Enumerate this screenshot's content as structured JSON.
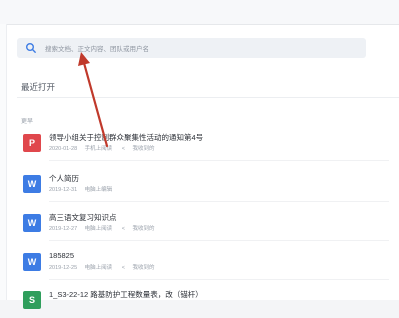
{
  "search": {
    "placeholder": "搜索文档、正文内容、团队或用户名"
  },
  "section_title": "最近打开",
  "group_label": "更早",
  "colors": {
    "pdf_icon": "#e0474c",
    "word_icon": "#3d7ce4"
  },
  "files": [
    {
      "name": "领导小组关于控制群众聚集性活动的通知第4号",
      "date": "2020-01-28",
      "source": "手机上阅读",
      "shared": "我收到的",
      "icon": "pdf-icon",
      "icon_glyph": "P"
    },
    {
      "name": "个人简历",
      "date": "2019-12-31",
      "source": "电脑上编辑",
      "shared": "",
      "icon": "word-icon",
      "icon_glyph": "W"
    },
    {
      "name": "高三语文复习知识点",
      "date": "2019-12-27",
      "source": "电脑上阅读",
      "shared": "我收到的",
      "icon": "word-icon",
      "icon_glyph": "W"
    },
    {
      "name": "185825",
      "date": "2019-12-25",
      "source": "电脑上阅读",
      "shared": "我收到的",
      "icon": "word-icon",
      "icon_glyph": "W"
    },
    {
      "name": "1_S3-22-12 路基防护工程数量表，改（锚杆）",
      "date": "",
      "source": "",
      "shared": "",
      "icon": "sheet-icon",
      "icon_glyph": "S"
    }
  ]
}
